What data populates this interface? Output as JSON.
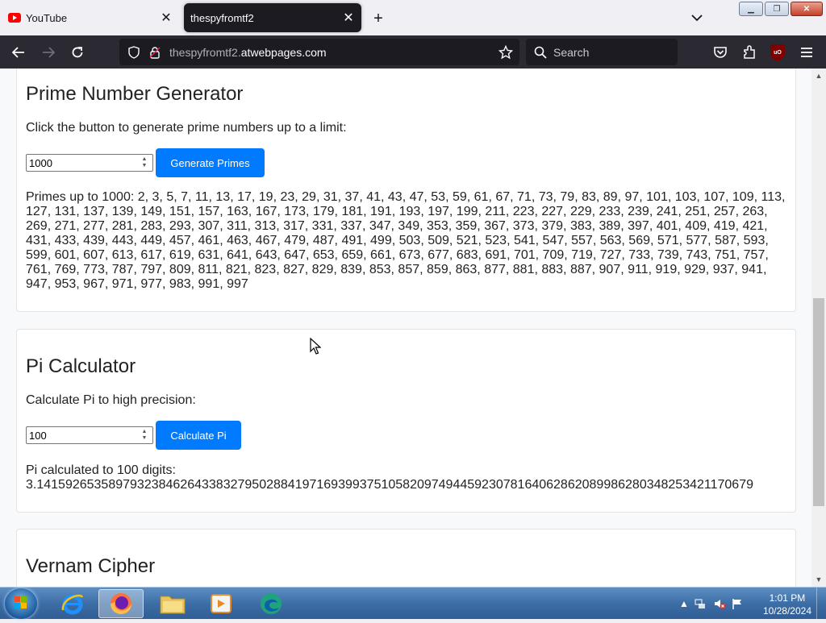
{
  "browser": {
    "tabs": [
      {
        "title": "YouTube",
        "active": false
      },
      {
        "title": "thespyfromtf2",
        "active": true
      }
    ],
    "url": {
      "subdomain": "thespyfromtf2.",
      "domain": "atwebpages.com"
    },
    "search_placeholder": "Search",
    "ublock_label": "uO"
  },
  "page": {
    "prime": {
      "title": "Prime Number Generator",
      "description": "Click the button to generate prime numbers up to a limit:",
      "input_value": "1000",
      "button_label": "Generate Primes",
      "result": "Primes up to 1000: 2, 3, 5, 7, 11, 13, 17, 19, 23, 29, 31, 37, 41, 43, 47, 53, 59, 61, 67, 71, 73, 79, 83, 89, 97, 101, 103, 107, 109, 113, 127, 131, 137, 139, 149, 151, 157, 163, 167, 173, 179, 181, 191, 193, 197, 199, 211, 223, 227, 229, 233, 239, 241, 251, 257, 263, 269, 271, 277, 281, 283, 293, 307, 311, 313, 317, 331, 337, 347, 349, 353, 359, 367, 373, 379, 383, 389, 397, 401, 409, 419, 421, 431, 433, 439, 443, 449, 457, 461, 463, 467, 479, 487, 491, 499, 503, 509, 521, 523, 541, 547, 557, 563, 569, 571, 577, 587, 593, 599, 601, 607, 613, 617, 619, 631, 641, 643, 647, 653, 659, 661, 673, 677, 683, 691, 701, 709, 719, 727, 733, 739, 743, 751, 757, 761, 769, 773, 787, 797, 809, 811, 821, 823, 827, 829, 839, 853, 857, 859, 863, 877, 881, 883, 887, 907, 911, 919, 929, 937, 941, 947, 953, 967, 971, 977, 983, 991, 997"
    },
    "pi": {
      "title": "Pi Calculator",
      "description": "Calculate Pi to high precision:",
      "input_value": "100",
      "button_label": "Calculate Pi",
      "result_label": "Pi calculated to 100 digits:",
      "result_value": "3.1415926535897932384626433832795028841971693993751058209749445923078164062862089986280348253421170679"
    },
    "vernam": {
      "title": "Vernam Cipher"
    }
  },
  "taskbar": {
    "time": "1:01 PM",
    "date": "10/28/2024",
    "apps": [
      "internet-explorer",
      "firefox",
      "file-explorer",
      "media-player",
      "edge"
    ]
  },
  "colors": {
    "accent_button": "#007bff",
    "browser_dark": "#2b2a33"
  }
}
